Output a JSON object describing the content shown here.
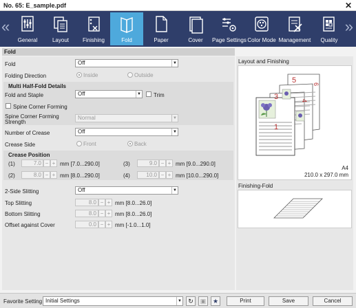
{
  "window": {
    "title": "No. 65: E_sample.pdf",
    "close_label": "✕"
  },
  "tabs": [
    {
      "label": "General"
    },
    {
      "label": "Layout"
    },
    {
      "label": "Finishing"
    },
    {
      "label": "Fold"
    },
    {
      "label": "Paper"
    },
    {
      "label": "Cover"
    },
    {
      "label": "Page Settings"
    },
    {
      "label": "Color Mode"
    },
    {
      "label": "Management"
    },
    {
      "label": "Quality"
    }
  ],
  "nav": {
    "prev": "«",
    "next": "»"
  },
  "section_title": "Fold",
  "fold": {
    "label": "Fold",
    "value": "Off"
  },
  "folding_direction": {
    "label": "Folding Direction",
    "option1": "Inside",
    "option2": "Outside"
  },
  "multi_half_fold": {
    "heading": "Multi Half-Fold Details",
    "fold_and_staple_label": "Fold and Staple",
    "fold_and_staple_value": "Off",
    "trim_label": "Trim",
    "spine_corner_forming_label": "Spine Corner Forming",
    "spine_strength_label_line1": "Spine Corner Forming",
    "spine_strength_label_line2": "Strength",
    "spine_strength_value": "Normal"
  },
  "number_of_crease": {
    "label": "Number of Crease",
    "value": "Off"
  },
  "crease_side": {
    "label": "Crease Side",
    "option1": "Front",
    "option2": "Back"
  },
  "crease_position": {
    "heading": "Crease Position",
    "items": [
      {
        "idx": "(1)",
        "value": "7.0",
        "range": "mm [7.0...290.0]"
      },
      {
        "idx": "(2)",
        "value": "8.0",
        "range": "mm [8.0...290.0]"
      },
      {
        "idx": "(3)",
        "value": "9.0",
        "range": "mm [9.0...290.0]"
      },
      {
        "idx": "(4)",
        "value": "10.0",
        "range": "mm [10.0...290.0]"
      }
    ]
  },
  "slitting": {
    "two_side_label": "2-Side Slitting",
    "two_side_value": "Off",
    "top_label": "Top Slitting",
    "top_value": "8.0",
    "top_range": "mm [8.0...26.0]",
    "bottom_label": "Bottom Slitting",
    "bottom_value": "8.0",
    "bottom_range": "mm [8.0...26.0]",
    "offset_label": "Offset against Cover",
    "offset_value": "0.0",
    "offset_range": "mm [-1.0...1.0]"
  },
  "spin": {
    "minus": "−",
    "plus": "+"
  },
  "preview": {
    "layout_title": "Layout and Finishing",
    "paper_size": "A4",
    "paper_dims": "210.0 x 297.0 mm",
    "page_numbers": [
      "1",
      "3",
      "4",
      "5",
      "6"
    ],
    "finishing_title": "Finishing-Fold"
  },
  "bottom": {
    "favorite_label": "Favorite Setting",
    "favorite_value": "Initial Settings",
    "print_label": "Print",
    "save_label": "Save",
    "cancel_label": "Cancel"
  }
}
